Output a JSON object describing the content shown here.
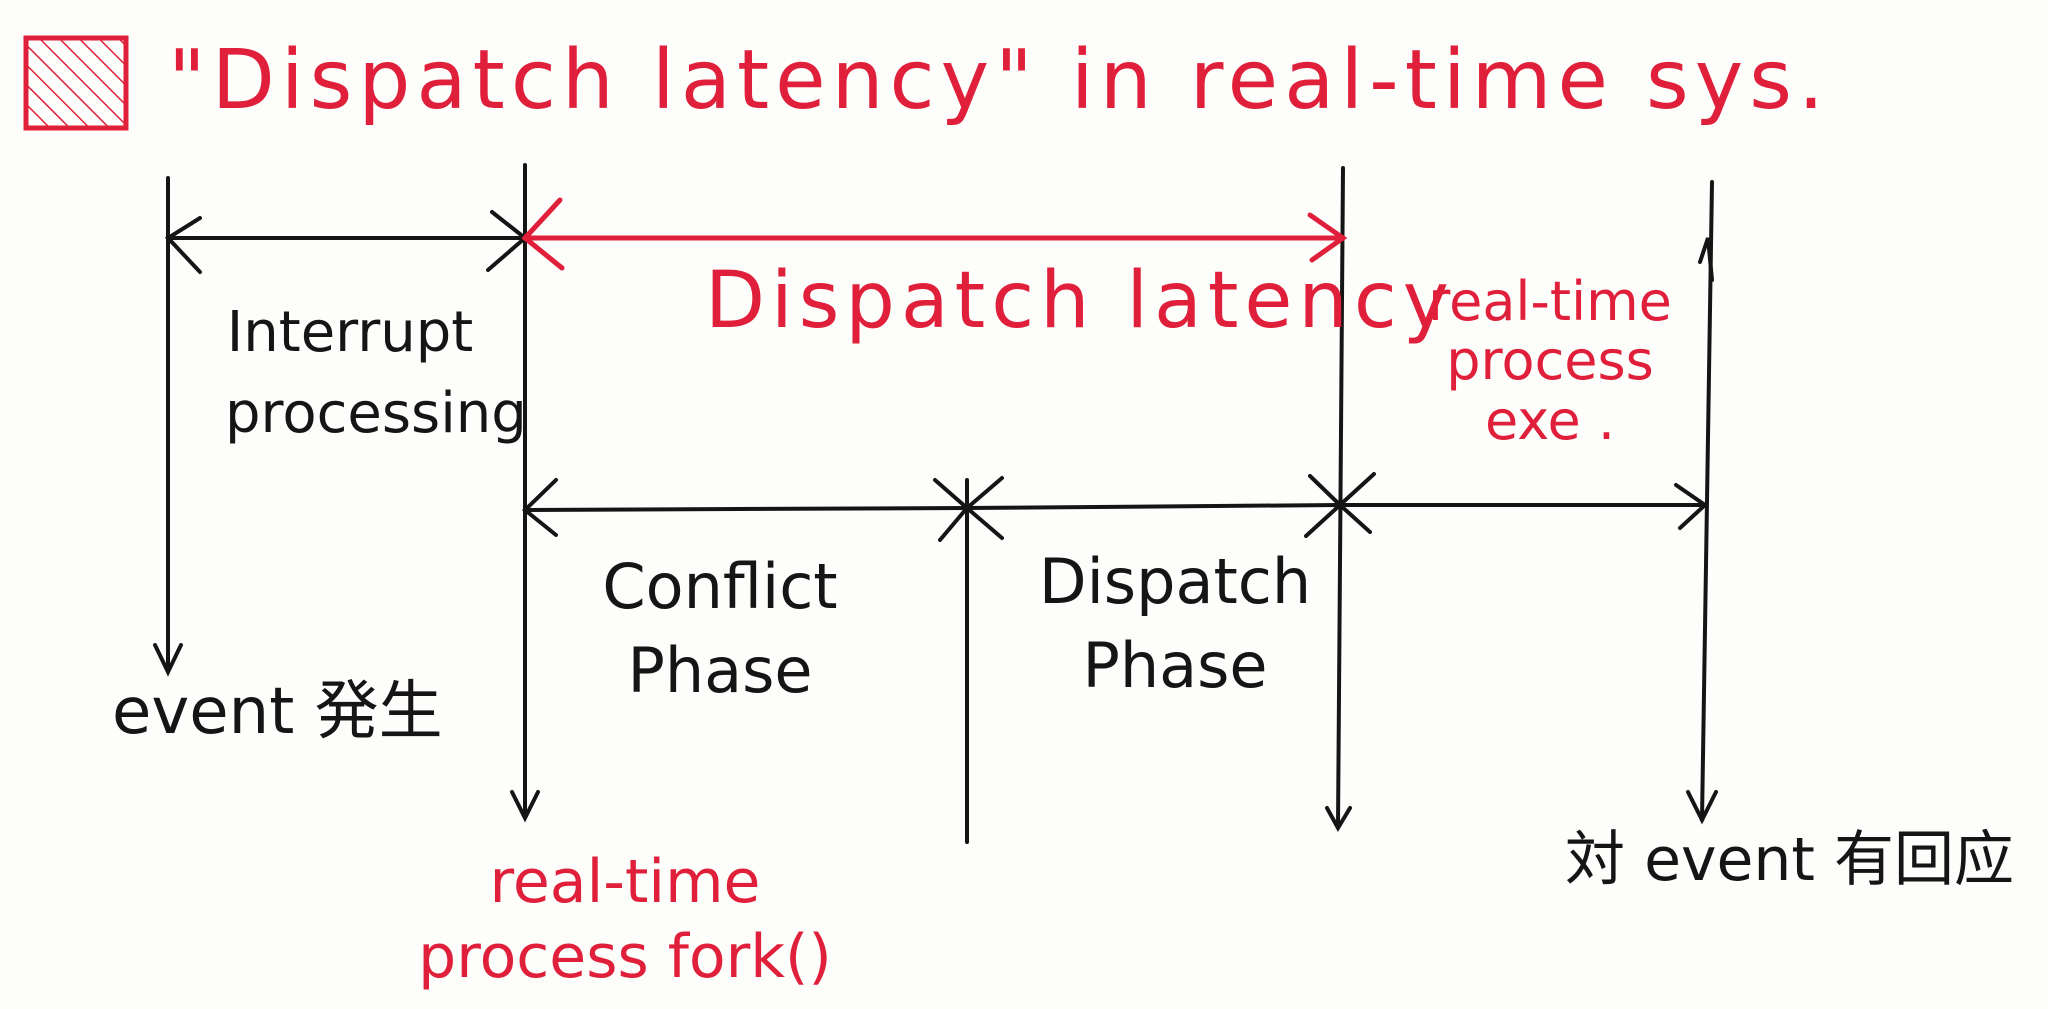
{
  "title": "\"Dispatch latency\" in real-time sys.",
  "colors": {
    "accent": "#e0203a",
    "ink": "#151515",
    "paper": "#fdfdfc"
  },
  "icon": "hatched-box-icon",
  "segments": {
    "interrupt_processing": "Interrupt processing",
    "dispatch_latency": "Dispatch latency",
    "realtime_exe": "real-time process exe .",
    "conflict_phase": "Conflict Phase",
    "dispatch_phase": "Dispatch Phase"
  },
  "events": {
    "event_occurs": "event 発生",
    "fork": "real-time process fork()",
    "response": "対 event 有回应"
  }
}
